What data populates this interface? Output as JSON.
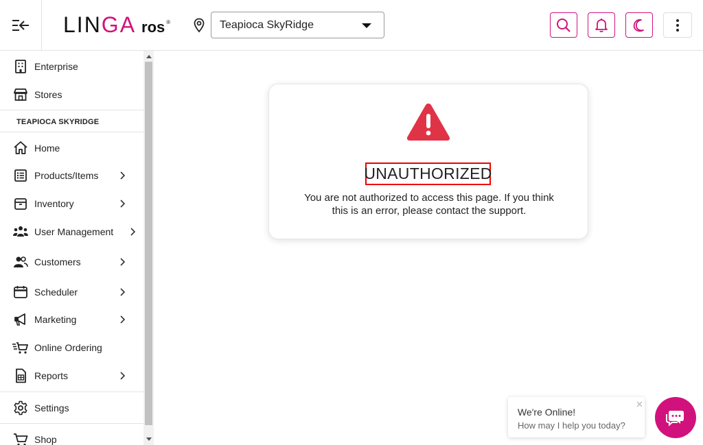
{
  "header": {
    "logo": {
      "part1": "LIN",
      "part2": "GA",
      "part3": "ros",
      "reg": "®"
    },
    "store_select": {
      "value": "Teapioca SkyRidge"
    },
    "colors": {
      "accent": "#d1127d"
    }
  },
  "sidebar": {
    "top_items": [
      {
        "label": "Enterprise",
        "icon": "building-icon"
      },
      {
        "label": "Stores",
        "icon": "store-icon"
      }
    ],
    "section_label": "TEAPIOCA SKYRIDGE",
    "items": [
      {
        "label": "Home",
        "icon": "home-icon",
        "has_submenu": false
      },
      {
        "label": "Products/Items",
        "icon": "list-icon",
        "has_submenu": true
      },
      {
        "label": "Inventory",
        "icon": "box-icon",
        "has_submenu": true
      },
      {
        "label": "User Management",
        "icon": "users-icon",
        "has_submenu": true
      },
      {
        "label": "Customers",
        "icon": "customers-icon",
        "has_submenu": true
      },
      {
        "label": "Scheduler",
        "icon": "calendar-icon",
        "has_submenu": true
      },
      {
        "label": "Marketing",
        "icon": "megaphone-icon",
        "has_submenu": true
      },
      {
        "label": "Online Ordering",
        "icon": "cart-fast-icon",
        "has_submenu": false
      },
      {
        "label": "Reports",
        "icon": "report-icon",
        "has_submenu": true
      }
    ],
    "bottom_items": [
      {
        "label": "Settings",
        "icon": "gear-icon"
      },
      {
        "label": "Shop",
        "icon": "cart-icon"
      }
    ]
  },
  "main": {
    "error": {
      "title": "UNAUTHORIZED",
      "message_line1": "You are not authorized to access this page. If you think",
      "message_line2": "this is an error, please contact the support.",
      "icon_color": "#e03446"
    }
  },
  "chat": {
    "status": "We're Online!",
    "prompt": "How may I help you today?"
  }
}
